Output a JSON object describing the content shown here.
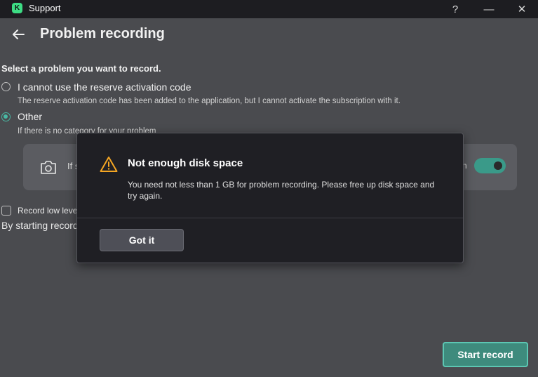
{
  "window": {
    "title": "Support",
    "logo_letter": "K",
    "help_glyph": "?",
    "minimize_glyph": "—",
    "close_glyph": "✕"
  },
  "header": {
    "title": "Problem recording",
    "back_icon": "arrow-left-icon"
  },
  "problem": {
    "section_label": "Select a problem you want to record.",
    "options": [
      {
        "label": "I cannot use the reserve activation code",
        "description": "The reserve activation code has been added to the application, but I cannot activate the subscription with it.",
        "selected": false
      },
      {
        "label": "Other",
        "description": "If there is no category for your problem",
        "selected": true
      }
    ]
  },
  "screenshot_card": {
    "icon": "camera-icon",
    "text_start": "If s",
    "text_end": "n",
    "toggle_on": true
  },
  "record_low_level": {
    "label": "Record low level",
    "checked": false
  },
  "footer_text": "By starting record",
  "start_button": "Start record",
  "dialog": {
    "icon": "warning-icon",
    "title": "Not enough disk space",
    "message": "You need not less than 1 GB for problem recording. Please free up disk space and try again.",
    "button": "Got it"
  },
  "colors": {
    "accent": "#49b9a4",
    "warning": "#f5a623",
    "background": "#4a4b4f",
    "dialog": "#1f1f24"
  }
}
